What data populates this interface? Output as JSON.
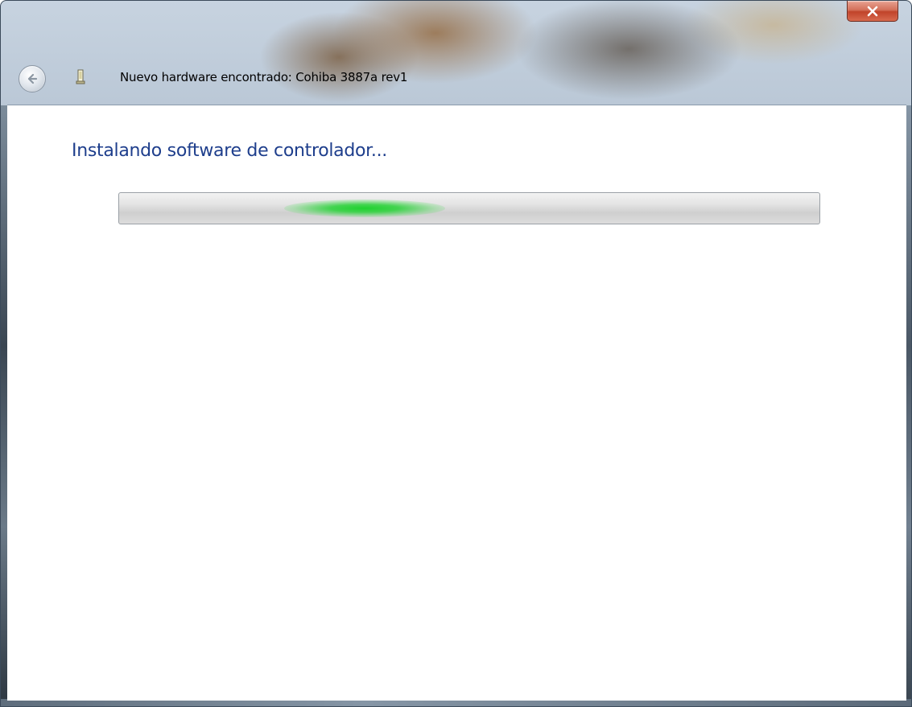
{
  "window": {
    "title": "Nuevo hardware encontrado: Cohiba 3887a rev1"
  },
  "content": {
    "heading": "Instalando software de controlador..."
  },
  "progress": {
    "mode": "indeterminate (marquee)",
    "glow_position_fraction": 0.35,
    "color": "#22c93a"
  },
  "icons": {
    "back": "back-arrow-icon",
    "device": "usb-device-icon",
    "close": "close-icon"
  },
  "colors": {
    "heading": "#1e3e8c",
    "close_button": "#c8452b"
  }
}
